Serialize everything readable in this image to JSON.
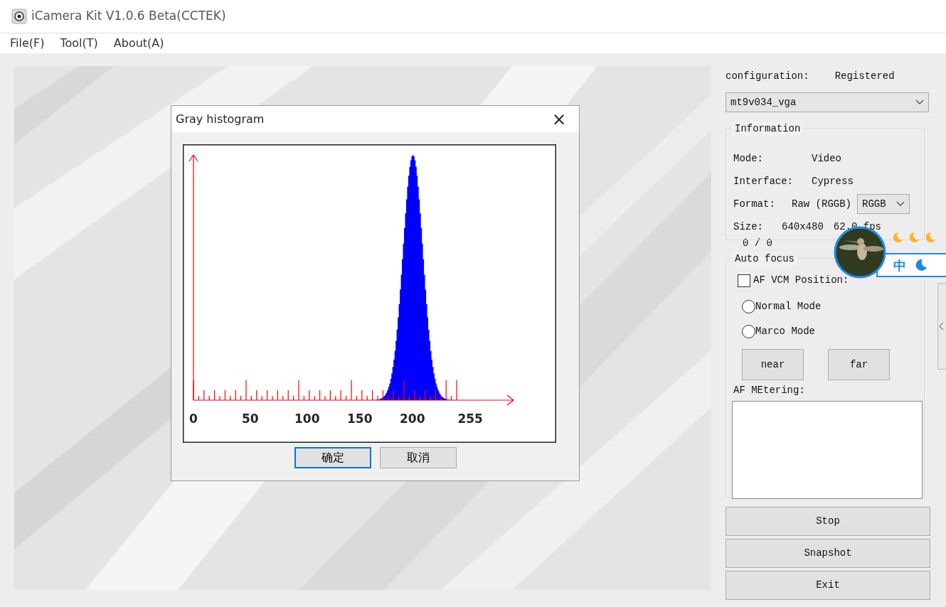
{
  "window": {
    "title": "iCamera Kit V1.0.6 Beta(CCTEK)"
  },
  "menu": [
    {
      "label": "File(F)"
    },
    {
      "label": "Tool(T)"
    },
    {
      "label": "About(A)"
    }
  ],
  "dialog": {
    "title": "Gray histogram",
    "close": "×",
    "x_labels": [
      "0",
      "50",
      "100",
      "150",
      "200",
      "255"
    ],
    "buttons": [
      {
        "label": "确定",
        "focused": true
      },
      {
        "label": "取消",
        "focused": false
      }
    ]
  },
  "panel": {
    "configuration_label": "configuration:",
    "registration": "Registered",
    "sensor": "mt9v034_vga",
    "information": {
      "title": "Information",
      "mode_label": "Mode:",
      "mode": "Video",
      "interface_label": "Interface:",
      "interface": "Cypress",
      "format_label": "Format:",
      "format": "Raw (RGGB)",
      "format_select": "RGGB",
      "size_label": "Size:",
      "size": "640x480",
      "fps": "62.0 fps"
    },
    "counter": "0 / 0",
    "auto_focus": {
      "title": "Auto focus",
      "checkbox": {
        "label": "AF VCM Position:",
        "checked": false
      },
      "radios": [
        {
          "label": "Normal Mode",
          "selected": false
        },
        {
          "label": "Marco Mode",
          "selected": false
        }
      ],
      "buttons": [
        "near",
        "far"
      ],
      "metering_label": "AF MEtering:"
    },
    "buttons": [
      "Stop",
      "Snapshot",
      "Exit"
    ]
  },
  "ime": {
    "char": "中"
  }
}
